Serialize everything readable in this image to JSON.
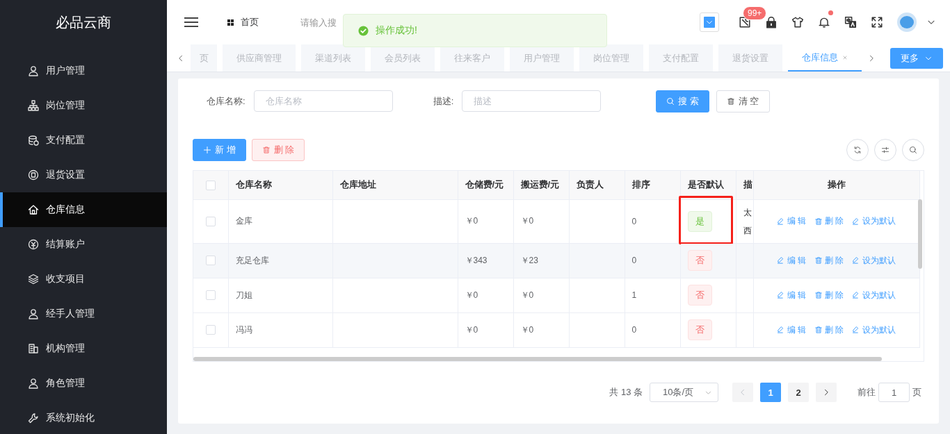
{
  "sidebar": {
    "logo": "必品云商",
    "items": [
      {
        "label": "用户管理",
        "selected": false
      },
      {
        "label": "岗位管理",
        "selected": false
      },
      {
        "label": "支付配置",
        "selected": false
      },
      {
        "label": "退货设置",
        "selected": false
      },
      {
        "label": "仓库信息",
        "selected": true
      },
      {
        "label": "结算账户",
        "selected": false
      },
      {
        "label": "收支项目",
        "selected": false
      },
      {
        "label": "经手人管理",
        "selected": false
      },
      {
        "label": "机构管理",
        "selected": false
      },
      {
        "label": "角色管理",
        "selected": false
      },
      {
        "label": "系统初始化",
        "selected": false
      }
    ]
  },
  "header": {
    "breadcrumb": "首页",
    "search": {
      "placeholder": "请输入搜"
    },
    "badge": "99+",
    "notification_dot": true
  },
  "toast": {
    "kind": "success",
    "message": "操作成功!"
  },
  "tabs": {
    "items": [
      {
        "label": "页",
        "selected": false
      },
      {
        "label": "供应商管理",
        "selected": false
      },
      {
        "label": "渠道列表",
        "selected": false
      },
      {
        "label": "会员列表",
        "selected": false
      },
      {
        "label": "往来客户",
        "selected": false
      },
      {
        "label": "用户管理",
        "selected": false
      },
      {
        "label": "岗位管理",
        "selected": false
      },
      {
        "label": "支付配置",
        "selected": false
      },
      {
        "label": "退货设置",
        "selected": false
      },
      {
        "label": "仓库信息",
        "selected": true
      }
    ],
    "more_button": "更多"
  },
  "filters": [
    {
      "label": "仓库名称:",
      "placeholder": "仓库名称"
    },
    {
      "label": "描述:",
      "placeholder": "描述"
    }
  ],
  "search_button": "搜 索",
  "clear_button": "清 空",
  "add_button": "新 增",
  "delete_button": "删 除",
  "table": {
    "select_all_checked": false,
    "columns": [
      "仓库名称",
      "仓库地址",
      "仓储费/元",
      "搬运费/元",
      "负责人",
      "排序",
      "是否默认",
      "描",
      "操作"
    ],
    "rows": [
      {
        "checked": false,
        "hovered": false,
        "highlighted": true,
        "name": "金库",
        "storage_fee": "￥0",
        "handling_fee": "￥0",
        "sort": "0",
        "default": true,
        "default_label": "是",
        "description": "太西",
        "actions": [
          {
            "kind": "edit",
            "label": "编 辑"
          },
          {
            "kind": "delete",
            "label": "删 除"
          },
          {
            "kind": "edit",
            "label": "设为默认"
          }
        ]
      },
      {
        "checked": false,
        "hovered": true,
        "highlighted": false,
        "name": "充足仓库",
        "storage_fee": "￥343",
        "handling_fee": "￥23",
        "sort": "0",
        "default": false,
        "default_label": "否",
        "actions": [
          {
            "kind": "edit",
            "label": "编 辑"
          },
          {
            "kind": "delete",
            "label": "删 除"
          },
          {
            "kind": "edit",
            "label": "设为默认"
          }
        ]
      },
      {
        "checked": false,
        "hovered": false,
        "highlighted": false,
        "name": "刀姐",
        "storage_fee": "￥0",
        "handling_fee": "￥0",
        "sort": "1",
        "default": false,
        "default_label": "否",
        "actions": [
          {
            "kind": "edit",
            "label": "编 辑"
          },
          {
            "kind": "delete",
            "label": "删 除"
          },
          {
            "kind": "edit",
            "label": "设为默认"
          }
        ]
      },
      {
        "checked": false,
        "hovered": false,
        "highlighted": false,
        "name": "冯冯",
        "storage_fee": "￥0",
        "handling_fee": "￥0",
        "sort": "0",
        "default": false,
        "default_label": "否",
        "actions": [
          {
            "kind": "edit",
            "label": "编 辑"
          },
          {
            "kind": "delete",
            "label": "删 除"
          },
          {
            "kind": "edit",
            "label": "设为默认"
          }
        ]
      }
    ]
  },
  "pagination": {
    "total": "共 13 条",
    "page_size": "10条/页",
    "pages": [
      {
        "label": "1",
        "selected": true
      },
      {
        "label": "2",
        "selected": false
      }
    ],
    "goto_label": "前往",
    "goto_value": "1",
    "page_suffix": "页"
  }
}
